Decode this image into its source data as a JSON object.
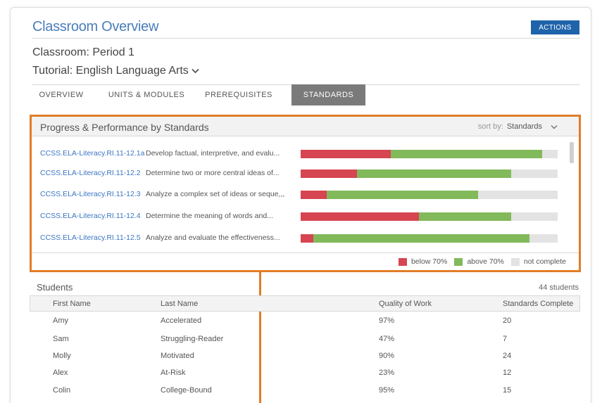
{
  "header": {
    "title": "Classroom Overview",
    "actions_label": "ACTIONS",
    "classroom": "Classroom: Period 1",
    "tutorial": "Tutorial: English Language Arts"
  },
  "tabs": [
    {
      "label": "OVERVIEW"
    },
    {
      "label": "UNITS & MODULES"
    },
    {
      "label": "PREREQUISITES"
    },
    {
      "label": "STANDARDS",
      "active": true
    }
  ],
  "standards_panel": {
    "title": "Progress & Performance by Standards",
    "sort_label": "sort by:",
    "sort_value": "Standards",
    "rows": [
      {
        "code": "CCSS.ELA-Literacy.RI.11-12.1a",
        "desc": "Develop factual, interpretive, and evalu...",
        "below": 35,
        "above": 59
      },
      {
        "code": "CCSS.ELA-Literacy.RI.11-12.2",
        "desc": "Determine two or more central ideas of...",
        "below": 22,
        "above": 60
      },
      {
        "code": "CCSS.ELA-Literacy.RI.11-12.3",
        "desc": "Analyze a complex set of ideas or seque,,,",
        "below": 10,
        "above": 59
      },
      {
        "code": "CCSS.ELA-Literacy.RI.11-12.4",
        "desc": "Determine the meaning of words and...",
        "below": 46,
        "above": 36
      },
      {
        "code": "CCSS.ELA-Literacy.RI.11-12.5",
        "desc": "Analyze and evaluate the effectiveness...",
        "below": 5,
        "above": 84
      }
    ],
    "legend": {
      "below": "below 70%",
      "above": "above 70%",
      "not_complete": "not complete"
    },
    "colors": {
      "below": "#d64551",
      "above": "#82b95a",
      "not_complete": "#e3e3e3",
      "highlight": "#e07d27"
    }
  },
  "students": {
    "title": "Students",
    "count": "44 students",
    "columns": {
      "first": "First Name",
      "last": "Last Name",
      "quality": "Quality of Work",
      "standards": "Standards Complete"
    },
    "rows": [
      {
        "first": "Amy",
        "last": "Accelerated",
        "quality": "97%",
        "standards": "20"
      },
      {
        "first": "Sam",
        "last": "Struggling-Reader",
        "quality": "47%",
        "standards": "7"
      },
      {
        "first": "Molly",
        "last": "Motivated",
        "quality": "90%",
        "standards": "24"
      },
      {
        "first": "Alex",
        "last": "At-Risk",
        "quality": "23%",
        "standards": "12"
      },
      {
        "first": "Colin",
        "last": "College-Bound",
        "quality": "95%",
        "standards": "15"
      }
    ]
  }
}
